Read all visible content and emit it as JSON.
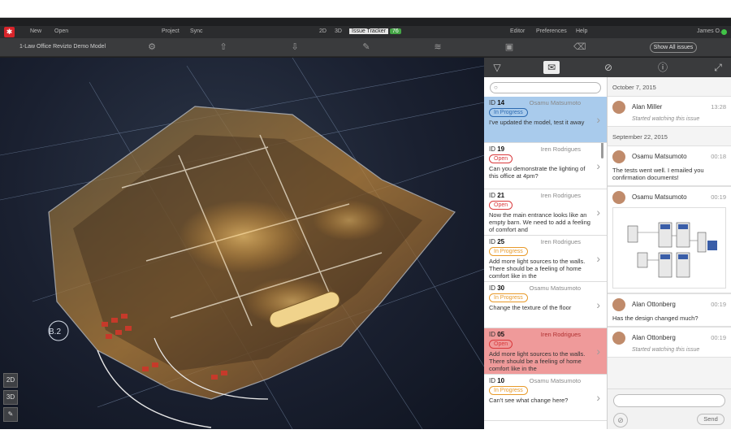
{
  "menubar": {
    "items": [
      "New",
      "Open",
      "Project",
      "Sync",
      "2D",
      "3D"
    ],
    "tracker": "Issue Tracker",
    "tracker_count": "76",
    "right_items": [
      "Editor",
      "Preferences",
      "Help"
    ],
    "user": "James O."
  },
  "toolbar": {
    "model_title": "1-Law Office Revizto Demo Model",
    "show_all_issues": "Show All issues"
  },
  "viewport": {
    "grid_labels": [
      "B.2"
    ],
    "left_tools": [
      "2D",
      "3D"
    ]
  },
  "issues": [
    {
      "id_label": "ID",
      "id": "14",
      "author": "Osamu Matsumoto",
      "status": "In Progress",
      "text": "I've updated the model, test it away",
      "state": "selected"
    },
    {
      "id_label": "ID",
      "id": "19",
      "author": "Iren Rodrigues",
      "status": "Open",
      "text": "Can you demonstrate the lighting of this office at 4pm?",
      "state": "normal"
    },
    {
      "id_label": "ID",
      "id": "21",
      "author": "Iren Rodrigues",
      "status": "Open",
      "text": "Now the main entrance looks like an empty barn. We need to add a feeling of comfort and",
      "state": "normal"
    },
    {
      "id_label": "ID",
      "id": "25",
      "author": "Iren Rodrigues",
      "status": "In Progress",
      "text": "Add more light sources to the walls. There should be a feeling of home comfort like in the",
      "state": "normal"
    },
    {
      "id_label": "ID",
      "id": "30",
      "author": "Osamu Matsumoto",
      "status": "In Progress",
      "text": "Change the texture of the floor",
      "state": "normal"
    },
    {
      "id_label": "ID",
      "id": "05",
      "author": "Iren Rodrigues",
      "status": "Open",
      "text": "Add more light sources to the walls. There should be a feeling of home comfort like in the",
      "state": "red"
    },
    {
      "id_label": "ID",
      "id": "10",
      "author": "Osamu Matsumoto",
      "status": "In Progress",
      "text": "Can't see what change here?",
      "state": "normal"
    }
  ],
  "activity": {
    "date1": "October 7, 2015",
    "date2": "September 22, 2015",
    "entries": [
      {
        "name": "Alan Miller",
        "time": "13:28",
        "sub": "Started watching this issue",
        "msg": ""
      },
      {
        "name": "Osamu Matsumoto",
        "time": "00:18",
        "sub": "",
        "msg": "The tests went well. I emailed you confirmation documents!"
      },
      {
        "name": "Osamu Matsumoto",
        "time": "00:19",
        "sub": "",
        "msg": ""
      },
      {
        "name": "Alan Ottonberg",
        "time": "00:19",
        "sub": "",
        "msg": "Has the design changed much?"
      },
      {
        "name": "Alan Ottonberg",
        "time": "00:19",
        "sub": "Started watching this issue",
        "msg": ""
      }
    ],
    "send": "Send"
  },
  "colors": {
    "accent_green": "#45a546",
    "open_red": "#d9393c",
    "progress_orange": "#e89a2a",
    "selected_blue": "#a9cbec"
  }
}
